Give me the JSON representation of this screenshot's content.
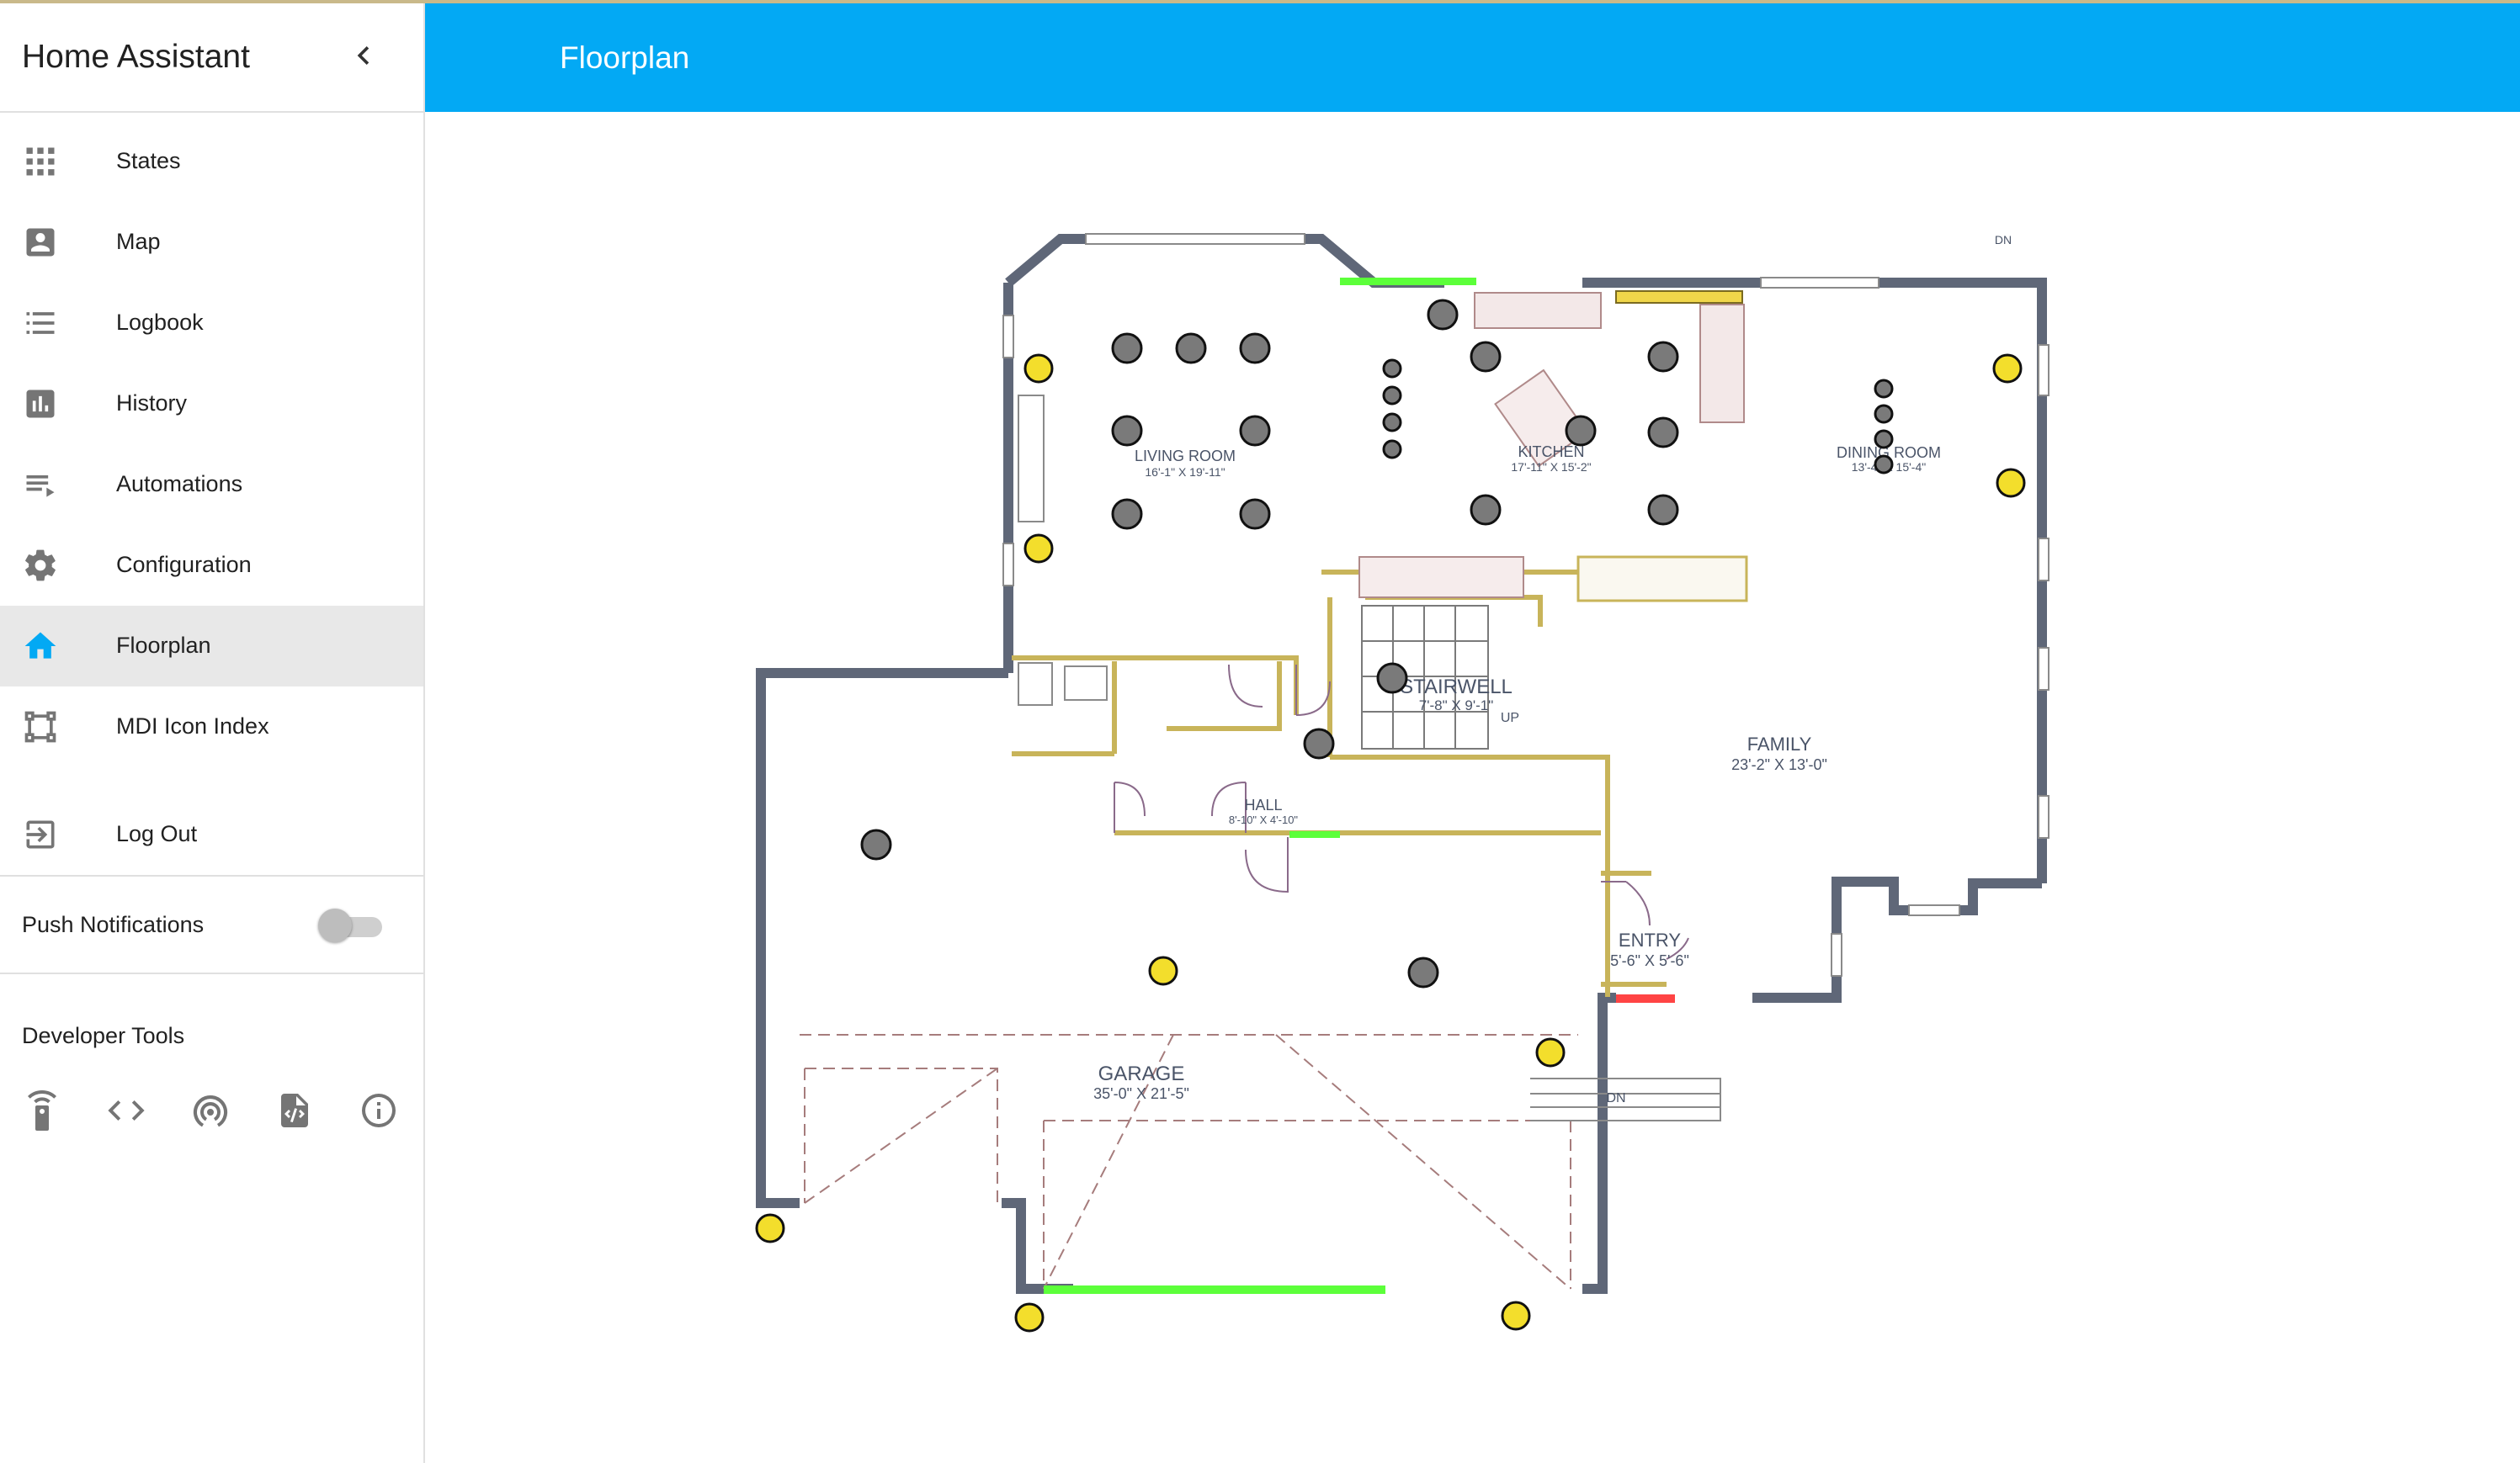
{
  "sidebar": {
    "title": "Home Assistant",
    "items": [
      {
        "label": "States",
        "icon": "grid-icon"
      },
      {
        "label": "Map",
        "icon": "map-account-icon"
      },
      {
        "label": "Logbook",
        "icon": "logbook-list-icon"
      },
      {
        "label": "History",
        "icon": "chart-bar-icon"
      },
      {
        "label": "Automations",
        "icon": "playlist-play-icon"
      },
      {
        "label": "Configuration",
        "icon": "gear-icon"
      },
      {
        "label": "Floorplan",
        "icon": "home-icon",
        "active": true
      },
      {
        "label": "MDI Icon Index",
        "icon": "vector-square-icon"
      }
    ],
    "logout_label": "Log Out",
    "push_label": "Push Notifications",
    "push_enabled": false,
    "dev_tools_label": "Developer Tools",
    "dev_tools": [
      "remote-icon",
      "code-brackets-icon",
      "broadcast-icon",
      "file-code-icon",
      "info-icon"
    ]
  },
  "header": {
    "title": "Floorplan",
    "color": "#03a9f4"
  },
  "floorplan": {
    "rooms": [
      {
        "name": "LIVING ROOM",
        "size": "16'-1\" X 19'-11\""
      },
      {
        "name": "KITCHEN",
        "size": "17'-11\" X 15'-2\""
      },
      {
        "name": "DINING ROOM",
        "size": "13'-4\" X 15'-4\""
      },
      {
        "name": "STAIRWELL",
        "size": "7'-8\" X 9'-1\""
      },
      {
        "name": "HALL",
        "size": "8'-10\" X 4'-10\""
      },
      {
        "name": "FAMILY",
        "size": "23'-2\" X 13'-0\""
      },
      {
        "name": "ENTRY",
        "size": "5'-6\" X 5'-6\""
      },
      {
        "name": "GARAGE",
        "size": "35'-0\" X 21'-5\""
      }
    ],
    "labels": {
      "up": "UP",
      "dn_top": "DN",
      "dn_entry": "DN"
    },
    "colors": {
      "light_on": "#f3de2c",
      "light_off": "#7a7a7a",
      "door_open": "#5cff3a",
      "door_closed": "#ff4444",
      "wall": "#5f6778",
      "cabinet": "#f0d64a"
    }
  }
}
